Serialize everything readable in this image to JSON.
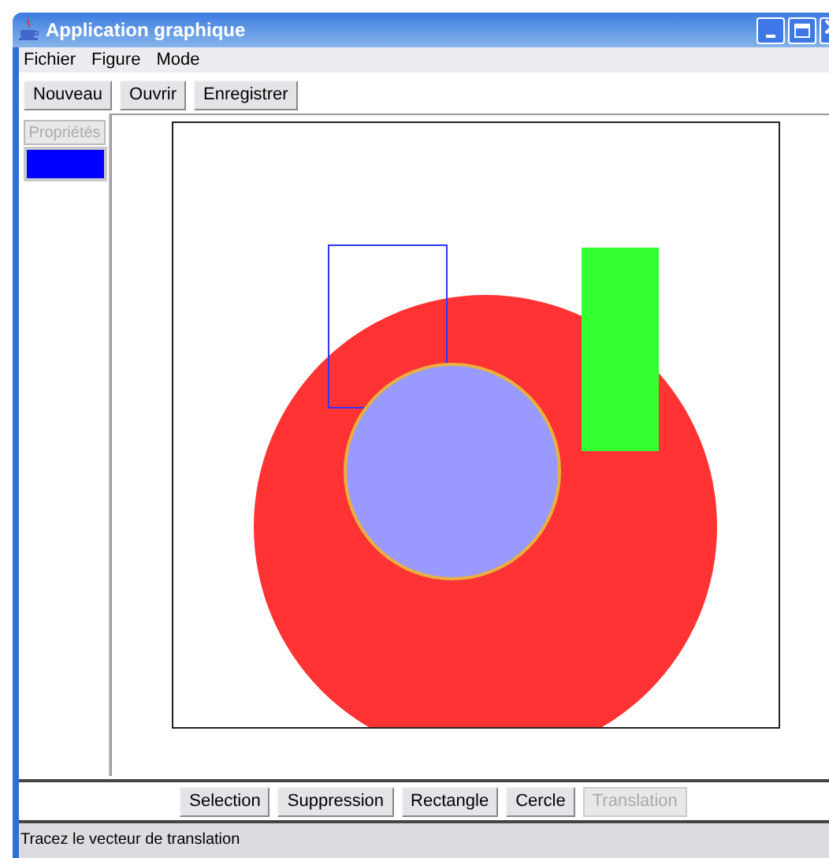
{
  "window": {
    "title": "Application graphique"
  },
  "menu": [
    "Fichier",
    "Figure",
    "Mode"
  ],
  "toolbar": [
    {
      "label": "Nouveau",
      "disabled": false
    },
    {
      "label": "Ouvrir",
      "disabled": false
    },
    {
      "label": "Enregistrer",
      "disabled": false
    }
  ],
  "properties": {
    "button": {
      "label": "Propriétés",
      "disabled": true
    },
    "color": "#0000ff"
  },
  "figures": [
    {
      "kind": "circle",
      "color": "#ff3333"
    },
    {
      "kind": "rectangle",
      "color": "#3333ff"
    },
    {
      "kind": "filled_rectangle",
      "color": "#33ff33"
    },
    {
      "kind": "circle",
      "color": "#9999ff"
    }
  ],
  "mode_buttons": [
    {
      "label": "Selection",
      "disabled": false
    },
    {
      "label": "Suppression",
      "disabled": false
    },
    {
      "label": "Rectangle",
      "disabled": false
    },
    {
      "label": "Cercle",
      "disabled": false
    },
    {
      "label": "Translation",
      "disabled": true
    }
  ],
  "status_bar": "Tracez le vecteur de translation"
}
